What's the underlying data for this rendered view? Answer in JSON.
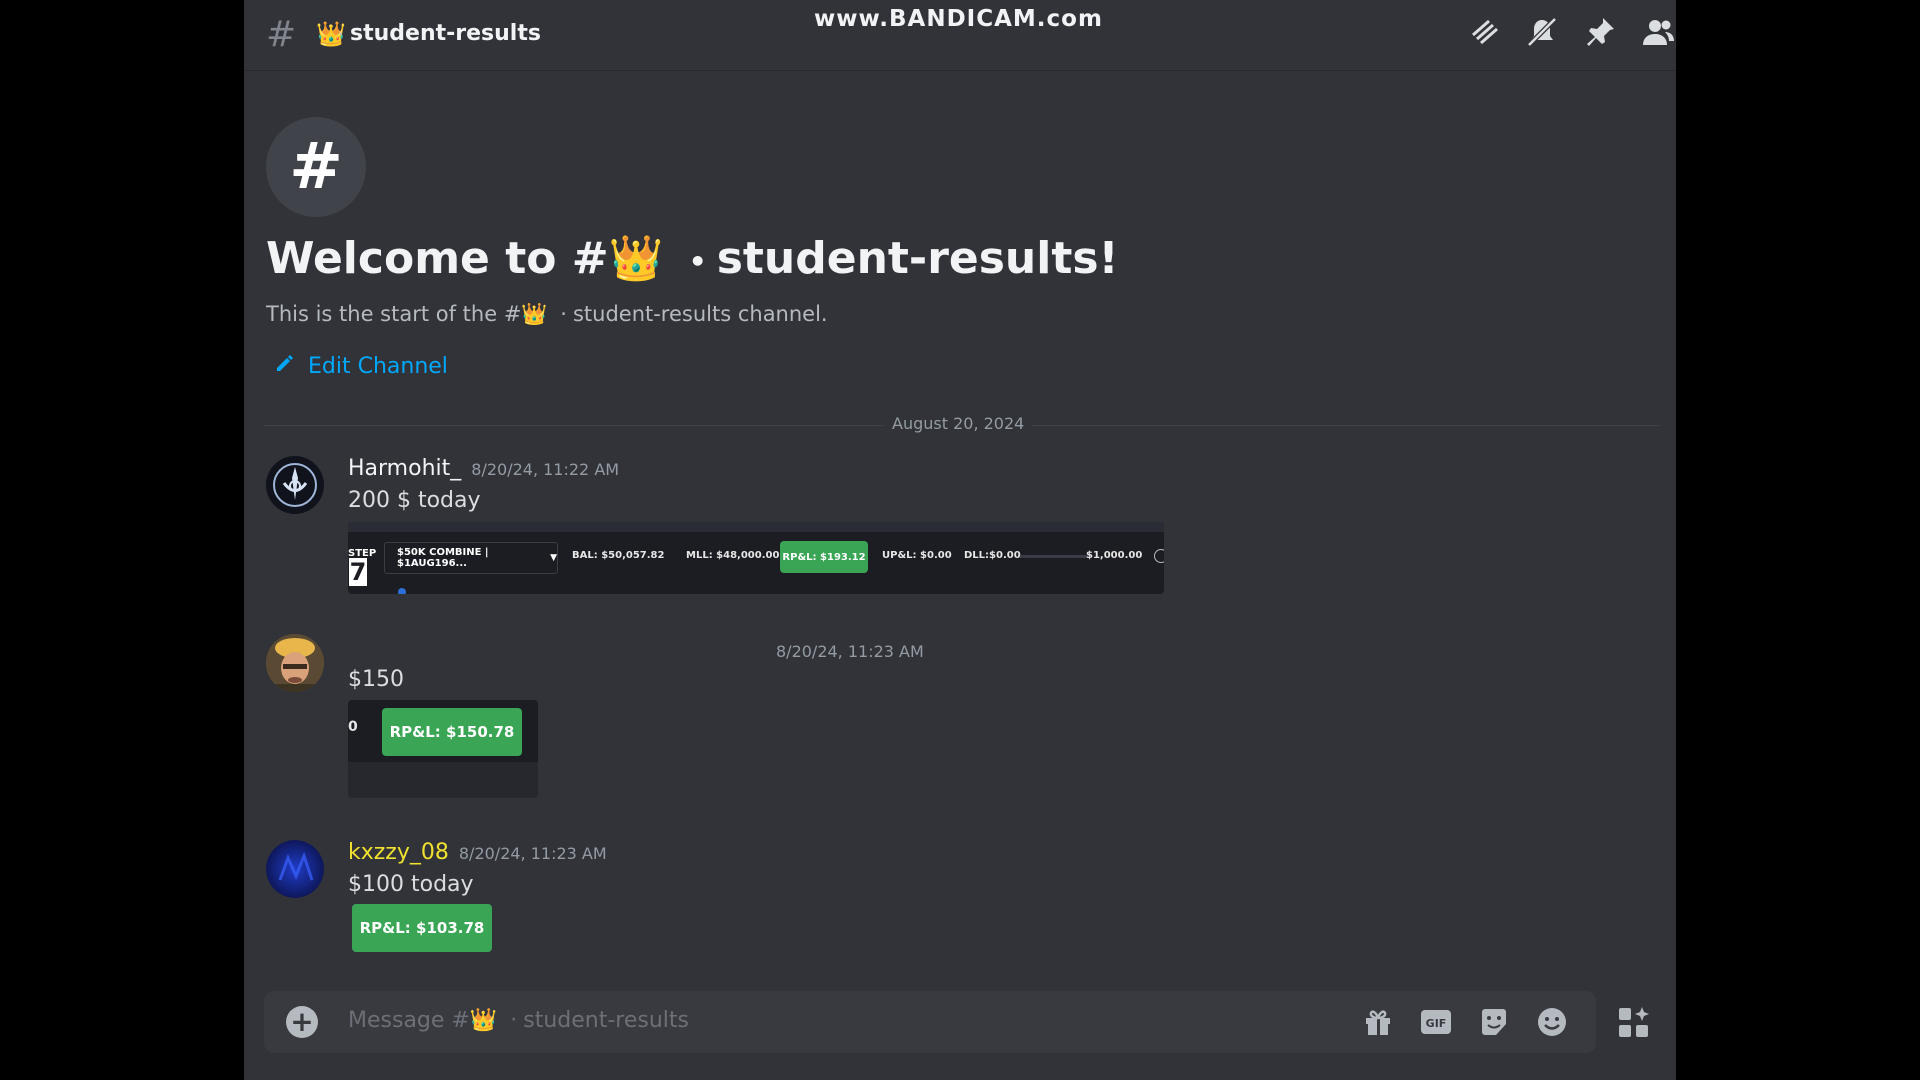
{
  "watermark": "www.BANDICAM.com",
  "header": {
    "channel_emoji": "👑",
    "channel_name": "student-results"
  },
  "intro": {
    "title_prefix": "Welcome to #",
    "title_emoji": "👑",
    "title_suffix": "student-results!",
    "subtitle_prefix": "This is the start of the #",
    "subtitle_emoji": "👑",
    "subtitle_suffix": "student-results channel.",
    "edit_label": "Edit Channel"
  },
  "divider_date": "August 20, 2024",
  "messages": [
    {
      "author": "Harmohit_",
      "timestamp": "8/20/24, 11:22 AM",
      "text": "200 $ today",
      "attachment": {
        "step_label": "STEP",
        "step_number": "7",
        "account": "$50K COMBINE | $1AUG196...",
        "bal": "BAL: $50,057.82",
        "mll": "MLL: $48,000.00",
        "rpl": "RP&L: $193.12",
        "upl": "UP&L: $0.00",
        "dll": "DLL:$0.00",
        "dll_max": "$1,000.00"
      }
    },
    {
      "author": "",
      "timestamp": "8/20/24, 11:23 AM",
      "text": "$150",
      "attachment": {
        "prefix": "0",
        "rpl": "RP&L: $150.78"
      }
    },
    {
      "author": "kxzzy_08",
      "author_color": "#f0e130",
      "timestamp": "8/20/24, 11:23 AM",
      "text": "$100 today",
      "attachment": {
        "rpl": "RP&L: $103.78"
      }
    }
  ],
  "composer": {
    "placeholder_prefix": "Message #",
    "placeholder_emoji": "👑",
    "placeholder_suffix": "student-results",
    "icons": [
      "gift-icon",
      "gif-icon",
      "sticker-icon",
      "emoji-icon",
      "apps-icon"
    ]
  },
  "top_icons": [
    "threads-icon",
    "notifications-muted-icon",
    "pin-icon",
    "members-icon"
  ],
  "colors": {
    "background": "#313338",
    "accent_link": "#00a8fc",
    "pnl_green": "#3aa655"
  }
}
